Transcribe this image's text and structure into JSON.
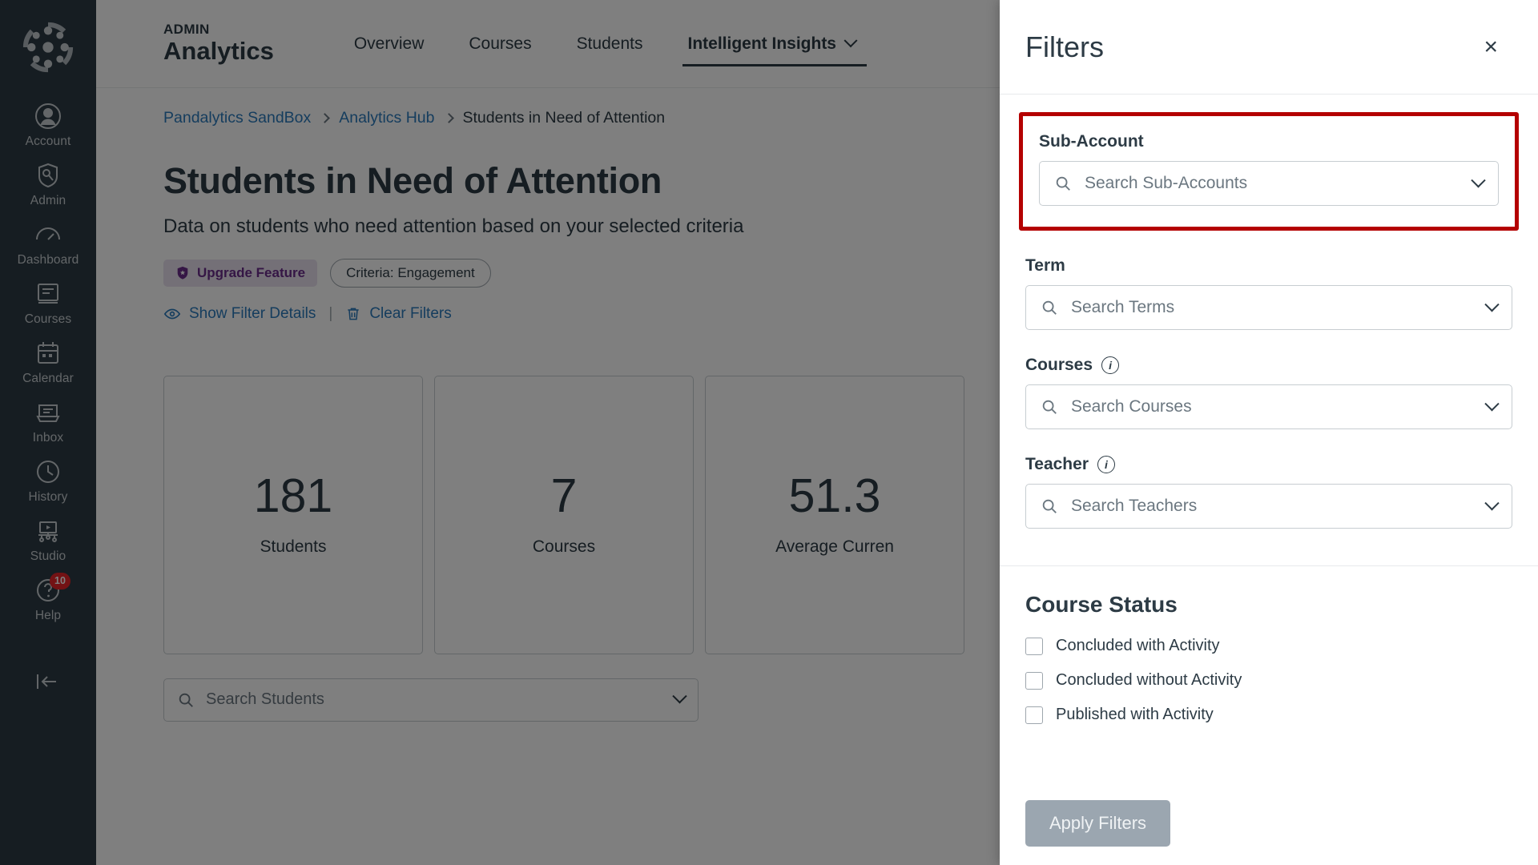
{
  "global_nav": {
    "logo_name": "canvas-logo",
    "items": [
      {
        "label": "Account",
        "icon": "account-icon"
      },
      {
        "label": "Admin",
        "icon": "admin-shield-icon"
      },
      {
        "label": "Dashboard",
        "icon": "dashboard-gauge-icon"
      },
      {
        "label": "Courses",
        "icon": "courses-book-icon"
      },
      {
        "label": "Calendar",
        "icon": "calendar-icon"
      },
      {
        "label": "Inbox",
        "icon": "inbox-icon"
      },
      {
        "label": "History",
        "icon": "history-clock-icon"
      },
      {
        "label": "Studio",
        "icon": "studio-icon"
      },
      {
        "label": "Help",
        "icon": "help-icon",
        "badge": "10"
      }
    ],
    "collapse_icon": "collapse-arrow-icon"
  },
  "header": {
    "eyebrow": "ADMIN",
    "title": "Analytics",
    "tabs": [
      {
        "label": "Overview",
        "active": false
      },
      {
        "label": "Courses",
        "active": false
      },
      {
        "label": "Students",
        "active": false
      },
      {
        "label": "Intelligent Insights",
        "active": true,
        "has_chevron": true
      }
    ]
  },
  "breadcrumb": {
    "items": [
      {
        "label": "Pandalytics SandBox",
        "link": true
      },
      {
        "label": "Analytics Hub",
        "link": true
      },
      {
        "label": "Students in Need of Attention",
        "link": false
      }
    ]
  },
  "main": {
    "title": "Students in Need of Attention",
    "subtitle": "Data on students who need attention based on your selected criteria",
    "upgrade_badge": "Upgrade Feature",
    "upgrade_icon": "shield-star-icon",
    "criteria_pill": "Criteria: Engagement",
    "show_filter_details": "Show Filter Details",
    "show_filter_details_icon": "eye-icon",
    "link_divider": "|",
    "clear_filters": "Clear Filters",
    "clear_filters_icon": "trash-icon",
    "stats": [
      {
        "value": "181",
        "label": "Students"
      },
      {
        "value": "7",
        "label": "Courses"
      },
      {
        "value": "51.3",
        "label": "Average Curren"
      }
    ],
    "student_search_placeholder": "Search Students",
    "student_search_icon": "search-icon",
    "student_search_chevron": "chevron-down-icon"
  },
  "filters_tray": {
    "title": "Filters",
    "close_icon": "close-icon",
    "close_glyph": "×",
    "highlight_color": "#B40000",
    "sub_account": {
      "label": "Sub-Account",
      "placeholder": "Search Sub-Accounts",
      "search_icon": "search-icon",
      "chevron_icon": "chevron-down-icon"
    },
    "term": {
      "label": "Term",
      "placeholder": "Search Terms",
      "search_icon": "search-icon",
      "chevron_icon": "chevron-down-icon"
    },
    "courses": {
      "label": "Courses",
      "info_icon": "info-icon",
      "info_glyph": "i",
      "placeholder": "Search Courses",
      "search_icon": "search-icon",
      "chevron_icon": "chevron-down-icon"
    },
    "teacher": {
      "label": "Teacher",
      "info_icon": "info-icon",
      "info_glyph": "i",
      "placeholder": "Search Teachers",
      "search_icon": "search-icon",
      "chevron_icon": "chevron-down-icon"
    },
    "course_status": {
      "title": "Course Status",
      "options": [
        {
          "label": "Concluded with Activity",
          "checked": false
        },
        {
          "label": "Concluded without Activity",
          "checked": false
        },
        {
          "label": "Published with Activity",
          "checked": false
        }
      ]
    },
    "apply_button": "Apply Filters"
  }
}
